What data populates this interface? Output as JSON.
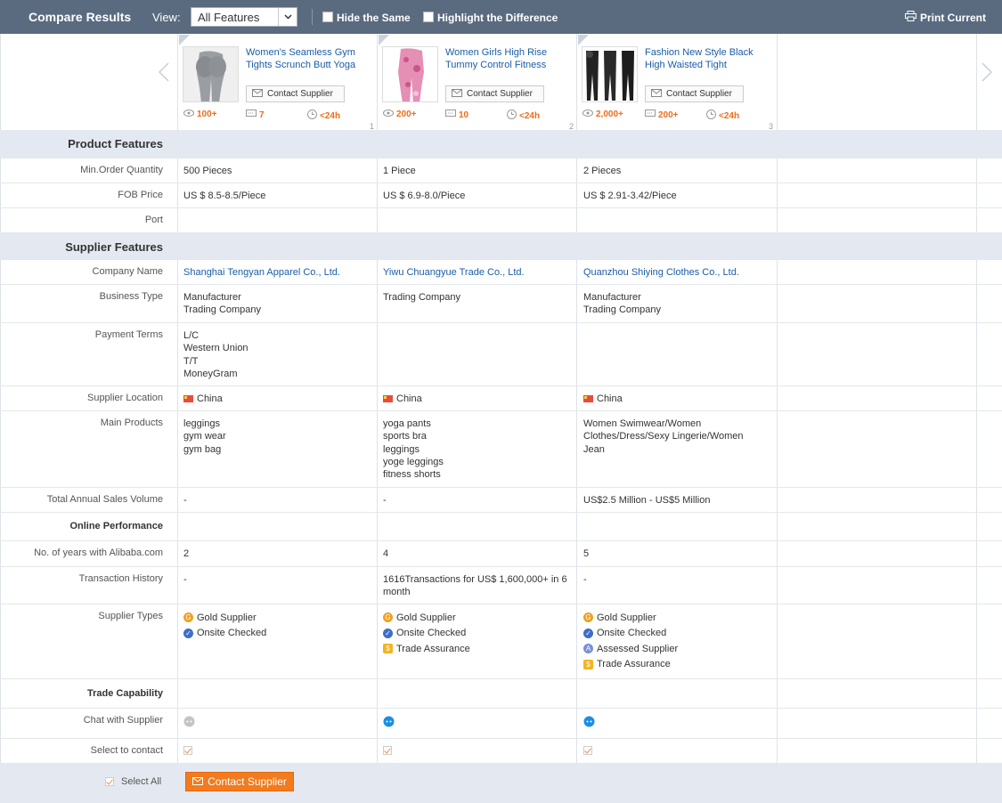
{
  "header": {
    "title": "Compare Results",
    "view_label": "View:",
    "view_value": "All Features",
    "hide_same": "Hide the Same",
    "highlight_diff": "Highlight the Difference",
    "print": "Print Current"
  },
  "products": [
    {
      "title": "Women's Seamless Gym Tights Scrunch Butt Yoga",
      "contact": "Contact Supplier",
      "views": "100+",
      "messages": "7",
      "response": "<24h",
      "index": "1"
    },
    {
      "title": "Women Girls High Rise Tummy Control Fitness",
      "contact": "Contact Supplier",
      "views": "200+",
      "messages": "10",
      "response": "<24h",
      "index": "2"
    },
    {
      "title": "Fashion New Style Black High Waisted Tight",
      "contact": "Contact Supplier",
      "views": "2,000+",
      "messages": "200+",
      "response": "<24h",
      "index": "3"
    }
  ],
  "sections": {
    "product_features": "Product Features",
    "supplier_features": "Supplier Features",
    "online_performance": "Online Performance",
    "trade_capability": "Trade Capability"
  },
  "labels": {
    "min_order": "Min.Order Quantity",
    "fob": "FOB Price",
    "port": "Port",
    "company": "Company Name",
    "business": "Business Type",
    "payment": "Payment Terms",
    "location": "Supplier Location",
    "main_products": "Main Products",
    "sales": "Total Annual Sales Volume",
    "years": "No. of years with Alibaba.com",
    "transactions": "Transaction History",
    "types": "Supplier Types",
    "chat": "Chat with Supplier",
    "select": "Select to contact"
  },
  "values": {
    "min_order": [
      "500 Pieces",
      "1 Piece",
      "2 Pieces"
    ],
    "fob": [
      "US $ 8.5-8.5/Piece",
      "US $ 6.9-8.0/Piece",
      "US $ 2.91-3.42/Piece"
    ],
    "company": [
      "Shanghai Tengyan Apparel Co., Ltd.",
      "Yiwu Chuangyue Trade Co., Ltd.",
      "Quanzhou Shiying Clothes Co., Ltd."
    ],
    "business": [
      [
        "Manufacturer",
        "Trading Company"
      ],
      [
        "Trading Company"
      ],
      [
        "Manufacturer",
        "Trading Company"
      ]
    ],
    "payment": [
      [
        "L/C",
        "Western Union",
        "T/T",
        "MoneyGram"
      ],
      [],
      []
    ],
    "location": [
      "China",
      "China",
      "China"
    ],
    "main_products": [
      [
        "leggings",
        "gym wear",
        "gym bag"
      ],
      [
        "yoga pants",
        "sports bra",
        "leggings",
        "yoge leggings",
        "fitness shorts"
      ],
      [
        "Women Swimwear/Women Clothes/Dress/Sexy Lingerie/Women Jean"
      ]
    ],
    "sales": [
      "-",
      "-",
      "US$2.5 Million - US$5 Million"
    ],
    "years": [
      "2",
      "4",
      "5"
    ],
    "transactions": [
      "-",
      "1616Transactions for US$ 1,600,000+ in 6 month",
      "-"
    ],
    "types": [
      [
        "Gold Supplier",
        "Onsite Checked"
      ],
      [
        "Gold Supplier",
        "Onsite Checked",
        "Trade Assurance"
      ],
      [
        "Gold Supplier",
        "Onsite Checked",
        "Assessed Supplier",
        "Trade Assurance"
      ]
    ]
  },
  "footer": {
    "select_all": "Select All",
    "contact": "Contact Supplier"
  },
  "colors": {
    "topbar": "#5a6b80",
    "section": "#e4e9f1",
    "link": "#1a5da8",
    "accent": "#f37b1d"
  }
}
